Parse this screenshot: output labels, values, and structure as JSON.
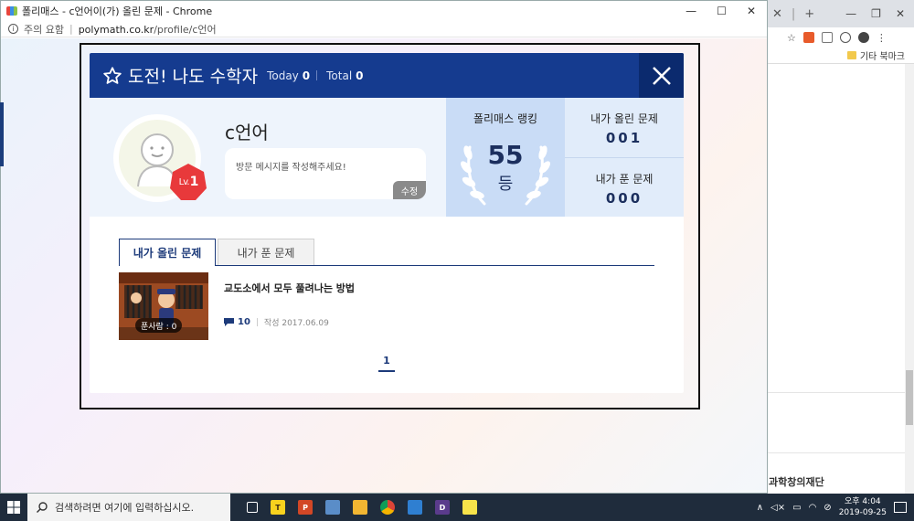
{
  "popup_window": {
    "title": "폴리매스 - c언어이(가) 올린 문제 - Chrome",
    "security_label": "주의 요함",
    "url_host": "polymath.co.kr",
    "url_path": "/profile/c언어",
    "controls": [
      "—",
      "☐",
      "✕"
    ]
  },
  "background_window": {
    "tab_close": "✕",
    "new_tab": "+",
    "bookmarks_label": "기타 북마크",
    "footer_text": "과학창의재단"
  },
  "dialog": {
    "title": "도전! 나도 수학자",
    "today_label": "Today",
    "today_value": "0",
    "total_label": "Total",
    "total_value": "0",
    "close_icon": "close-icon"
  },
  "profile": {
    "username": "c언어",
    "level_prefix": "Lv.",
    "level": "1",
    "message_placeholder": "방문 메시지를 작성해주세요!",
    "edit_label": "수정",
    "ranking_title": "폴리매스 랭킹",
    "ranking_value": "55",
    "ranking_unit": "등",
    "posted_label": "내가 올린 문제",
    "posted_value": "001",
    "solved_label": "내가 푼 문제",
    "solved_value": "000"
  },
  "tabs": [
    {
      "label": "내가 올린 문제",
      "active": true
    },
    {
      "label": "내가 푼 문제",
      "active": false
    }
  ],
  "problems": [
    {
      "title": "교도소에서 모두 풀려나는 방법",
      "solvers_label": "푼사람 : 0",
      "comments": "10",
      "date": "작성 2017.06.09"
    }
  ],
  "pagination": {
    "current": "1"
  },
  "taskbar": {
    "search_placeholder": "검색하려면 여기에 입력하십시오.",
    "time": "오후 4:04",
    "date": "2019-09-25"
  },
  "colors": {
    "header": "#153b8f",
    "close_bg": "#0b2a6e",
    "rank_bg": "#c9dcf6",
    "badge": "#e8393b"
  }
}
